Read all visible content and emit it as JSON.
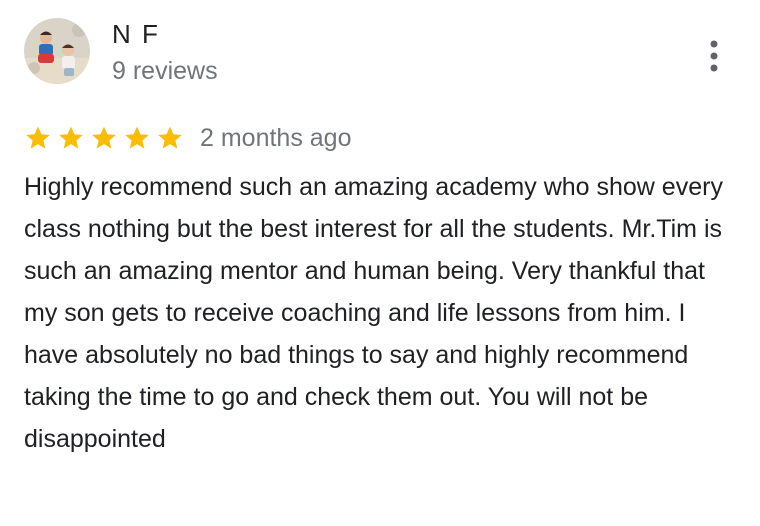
{
  "reviewer": {
    "name": "N F",
    "review_count": "9 reviews",
    "avatar_icon": "profile-photo-icon"
  },
  "menu": {
    "icon": "more-vertical-icon"
  },
  "review": {
    "rating": 5,
    "max_rating": 5,
    "date": "2 months ago",
    "text": "Highly recommend such an amazing academy who show every class nothing but the best interest for all the students. Mr.Tim is such an amazing mentor and human being. Very thankful that my son gets to receive coaching and life lessons from him. I have absolutely no bad things to say and highly recommend taking the time to go and check them out. You will not be disappointed"
  },
  "colors": {
    "star": "#fbbc04",
    "primary_text": "#202124",
    "secondary_text": "#70757a",
    "icon": "#5f6368"
  }
}
